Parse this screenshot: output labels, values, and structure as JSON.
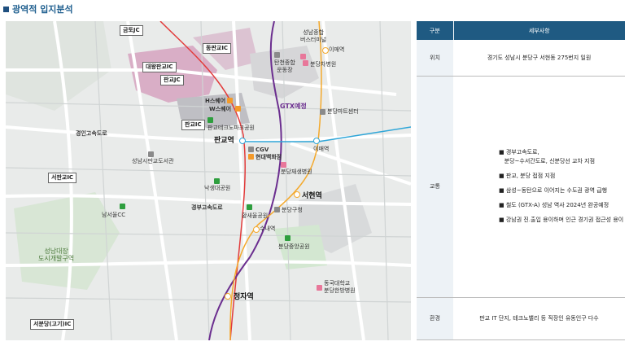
{
  "heading": "광역적 입지분석",
  "map": {
    "boxes": {
      "geumto_ic": "금토JC",
      "dongpangyo_ic": "동판교IC",
      "daewang_ic": "대왕판교IC",
      "pangyo_jc": "판교JC",
      "pangyo_ic": "판교IC",
      "seopangyo_ic": "서판교IC",
      "seobundang_ic": "서분당(고기)IC"
    },
    "stations": {
      "pangyo": "판교역",
      "seohyeon": "서현역",
      "jeongja": "정자역"
    },
    "labels": {
      "seongnam_terminal": "성남종합\n버스터미널",
      "imae_stn_top": "이매역",
      "tancheon": "탄천종합\n운동장",
      "bundang_cha": "분당차병원",
      "hsquare": "H스퀘어",
      "wsquare": "W스퀘어",
      "gtx": "GTX예정",
      "bundang_mart": "분당마트센터",
      "pangyo_techno_park": "판교테크노파크공원",
      "gyeongin_expwy": "경인고속도로",
      "cgv": "CGV",
      "hyundai": "현대백화점",
      "imae_stn": "이매역",
      "library": "성남시판교도서관",
      "bundang_jesaeng": "분당재생병원",
      "hwarang_park": "낙생대공원",
      "gyeongbu_expwy": "경부고속도로",
      "namseoul_cc": "남서울CC",
      "hwangsaeul_park": "황새울공원",
      "bundang_office": "분당구청",
      "sunae": "수내역",
      "seongnam_daejang": "성남대장\n도시개발구역",
      "central_park": "분당중앙공원",
      "dongguk": "동국대학교\n분당한방병원"
    }
  },
  "table": {
    "headers": [
      "구분",
      "세부사항"
    ],
    "rows": [
      {
        "category": "위치",
        "detail": "경기도 성남시 분당구 서현동 275번지 일원"
      },
      {
        "category": "교통",
        "items": [
          "■ 경부고속도로,\n   분당~수서간도로, 신분당선 교차 지점",
          "■ 판교, 분당 접점 지점",
          "■ 삼성~동탄으로 이어지는 수도권 광역 급행",
          "■ 철도 (GTX-A) 성남 역사 2024년 완공예정",
          "■ 강남권 진.출입 용이하며 인근 경기권 접근성 용이"
        ]
      },
      {
        "category": "환경",
        "detail": "판교 IT 단지, 테크노밸리 등 직장인 유동인구 다수"
      }
    ]
  },
  "colors": {
    "heading": "#1f5f8f",
    "table_header": "#1f5a82",
    "gtx_line": "#6b2e8f",
    "sinbundang_line": "#e23b3b",
    "bundang_line": "#f4a92c",
    "gyeonggang_line": "#2fa6d8",
    "park": "#2e9e3e"
  }
}
